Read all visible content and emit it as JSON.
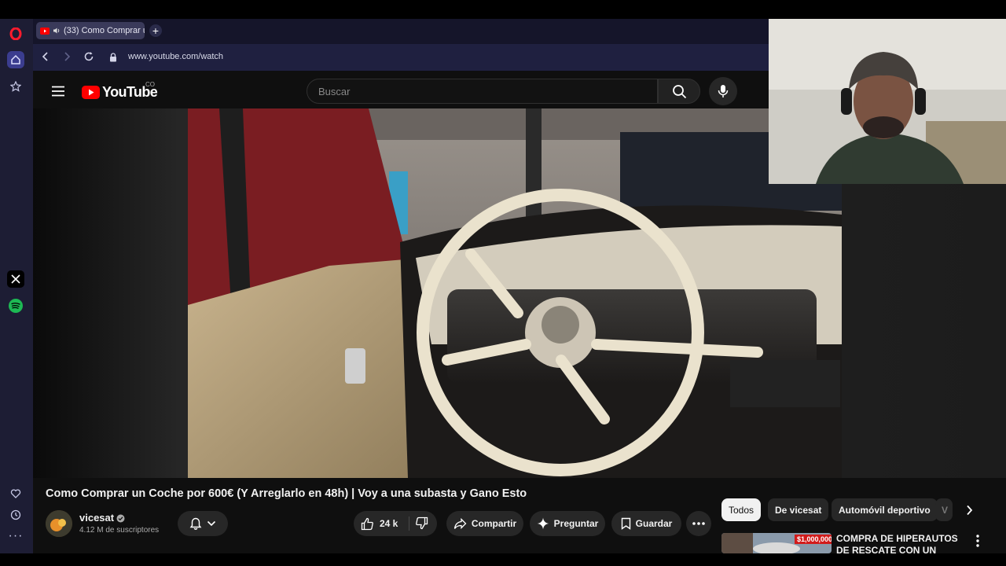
{
  "browser": {
    "tab_title": "(33) Como Comprar u",
    "url": "www.youtube.com/watch"
  },
  "youtube": {
    "logo_text": "YouTube",
    "region": "CO",
    "search_placeholder": "Buscar"
  },
  "video": {
    "title": "Como Comprar un Coche por 600€ (Y Arreglarlo en 48h) | Voy a una subasta y Gano Esto"
  },
  "channel": {
    "name": "vicesat",
    "subscribers": "4.12 M de suscriptores"
  },
  "actions": {
    "likes": "24 k",
    "share": "Compartir",
    "ask": "Preguntar",
    "save": "Guardar"
  },
  "chips": [
    "Todos",
    "De vicesat",
    "Automóvil deportivo",
    "V"
  ],
  "recommendation": {
    "title": "COMPRA DE HIPERAUTOS DE RESCATE CON UN",
    "thumb_badge": "$1,000,000"
  },
  "colors": {
    "youtube_red": "#ff0000",
    "browser_sidebar": "#1d1d34",
    "page_bg": "#0f0f0f"
  }
}
